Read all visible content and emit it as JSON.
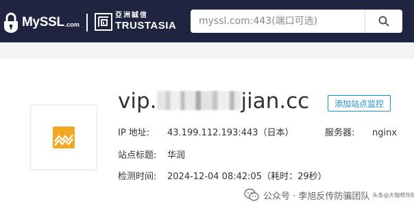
{
  "header": {
    "logo_text": "MySSL",
    "logo_suffix": ".com",
    "partner_logo_cn": "亞洲誠信",
    "partner_logo_en": "TRUSTASIA",
    "search_placeholder": "myssl.com:443(端口可选)"
  },
  "site": {
    "domain_prefix": "vip.",
    "domain_suffix": "jian.cc",
    "add_monitor_label": "添加站点监控",
    "fields": {
      "ip_label": "IP 地址:",
      "ip_value": "43.199.112.193:443（日本）",
      "server_label": "服务器:",
      "server_value": "nginx",
      "title_label": "站点标题:",
      "title_value": "华润",
      "time_label": "检测时间:",
      "time_value": "2024-12-04 08:42:05（耗时：29秒）"
    }
  },
  "watermark": {
    "text": "公众号 · 李旭反传防骗团队",
    "subtext": "头条@大咖帮你防骗"
  },
  "colors": {
    "header_bg": "#1f2440",
    "accent": "#1a8fd6",
    "favicon_orange": "#f5a623"
  },
  "icons": {
    "search": "search-icon",
    "lock": "lock-icon",
    "favicon": "site-favicon-icon",
    "wechat": "wechat-icon"
  }
}
